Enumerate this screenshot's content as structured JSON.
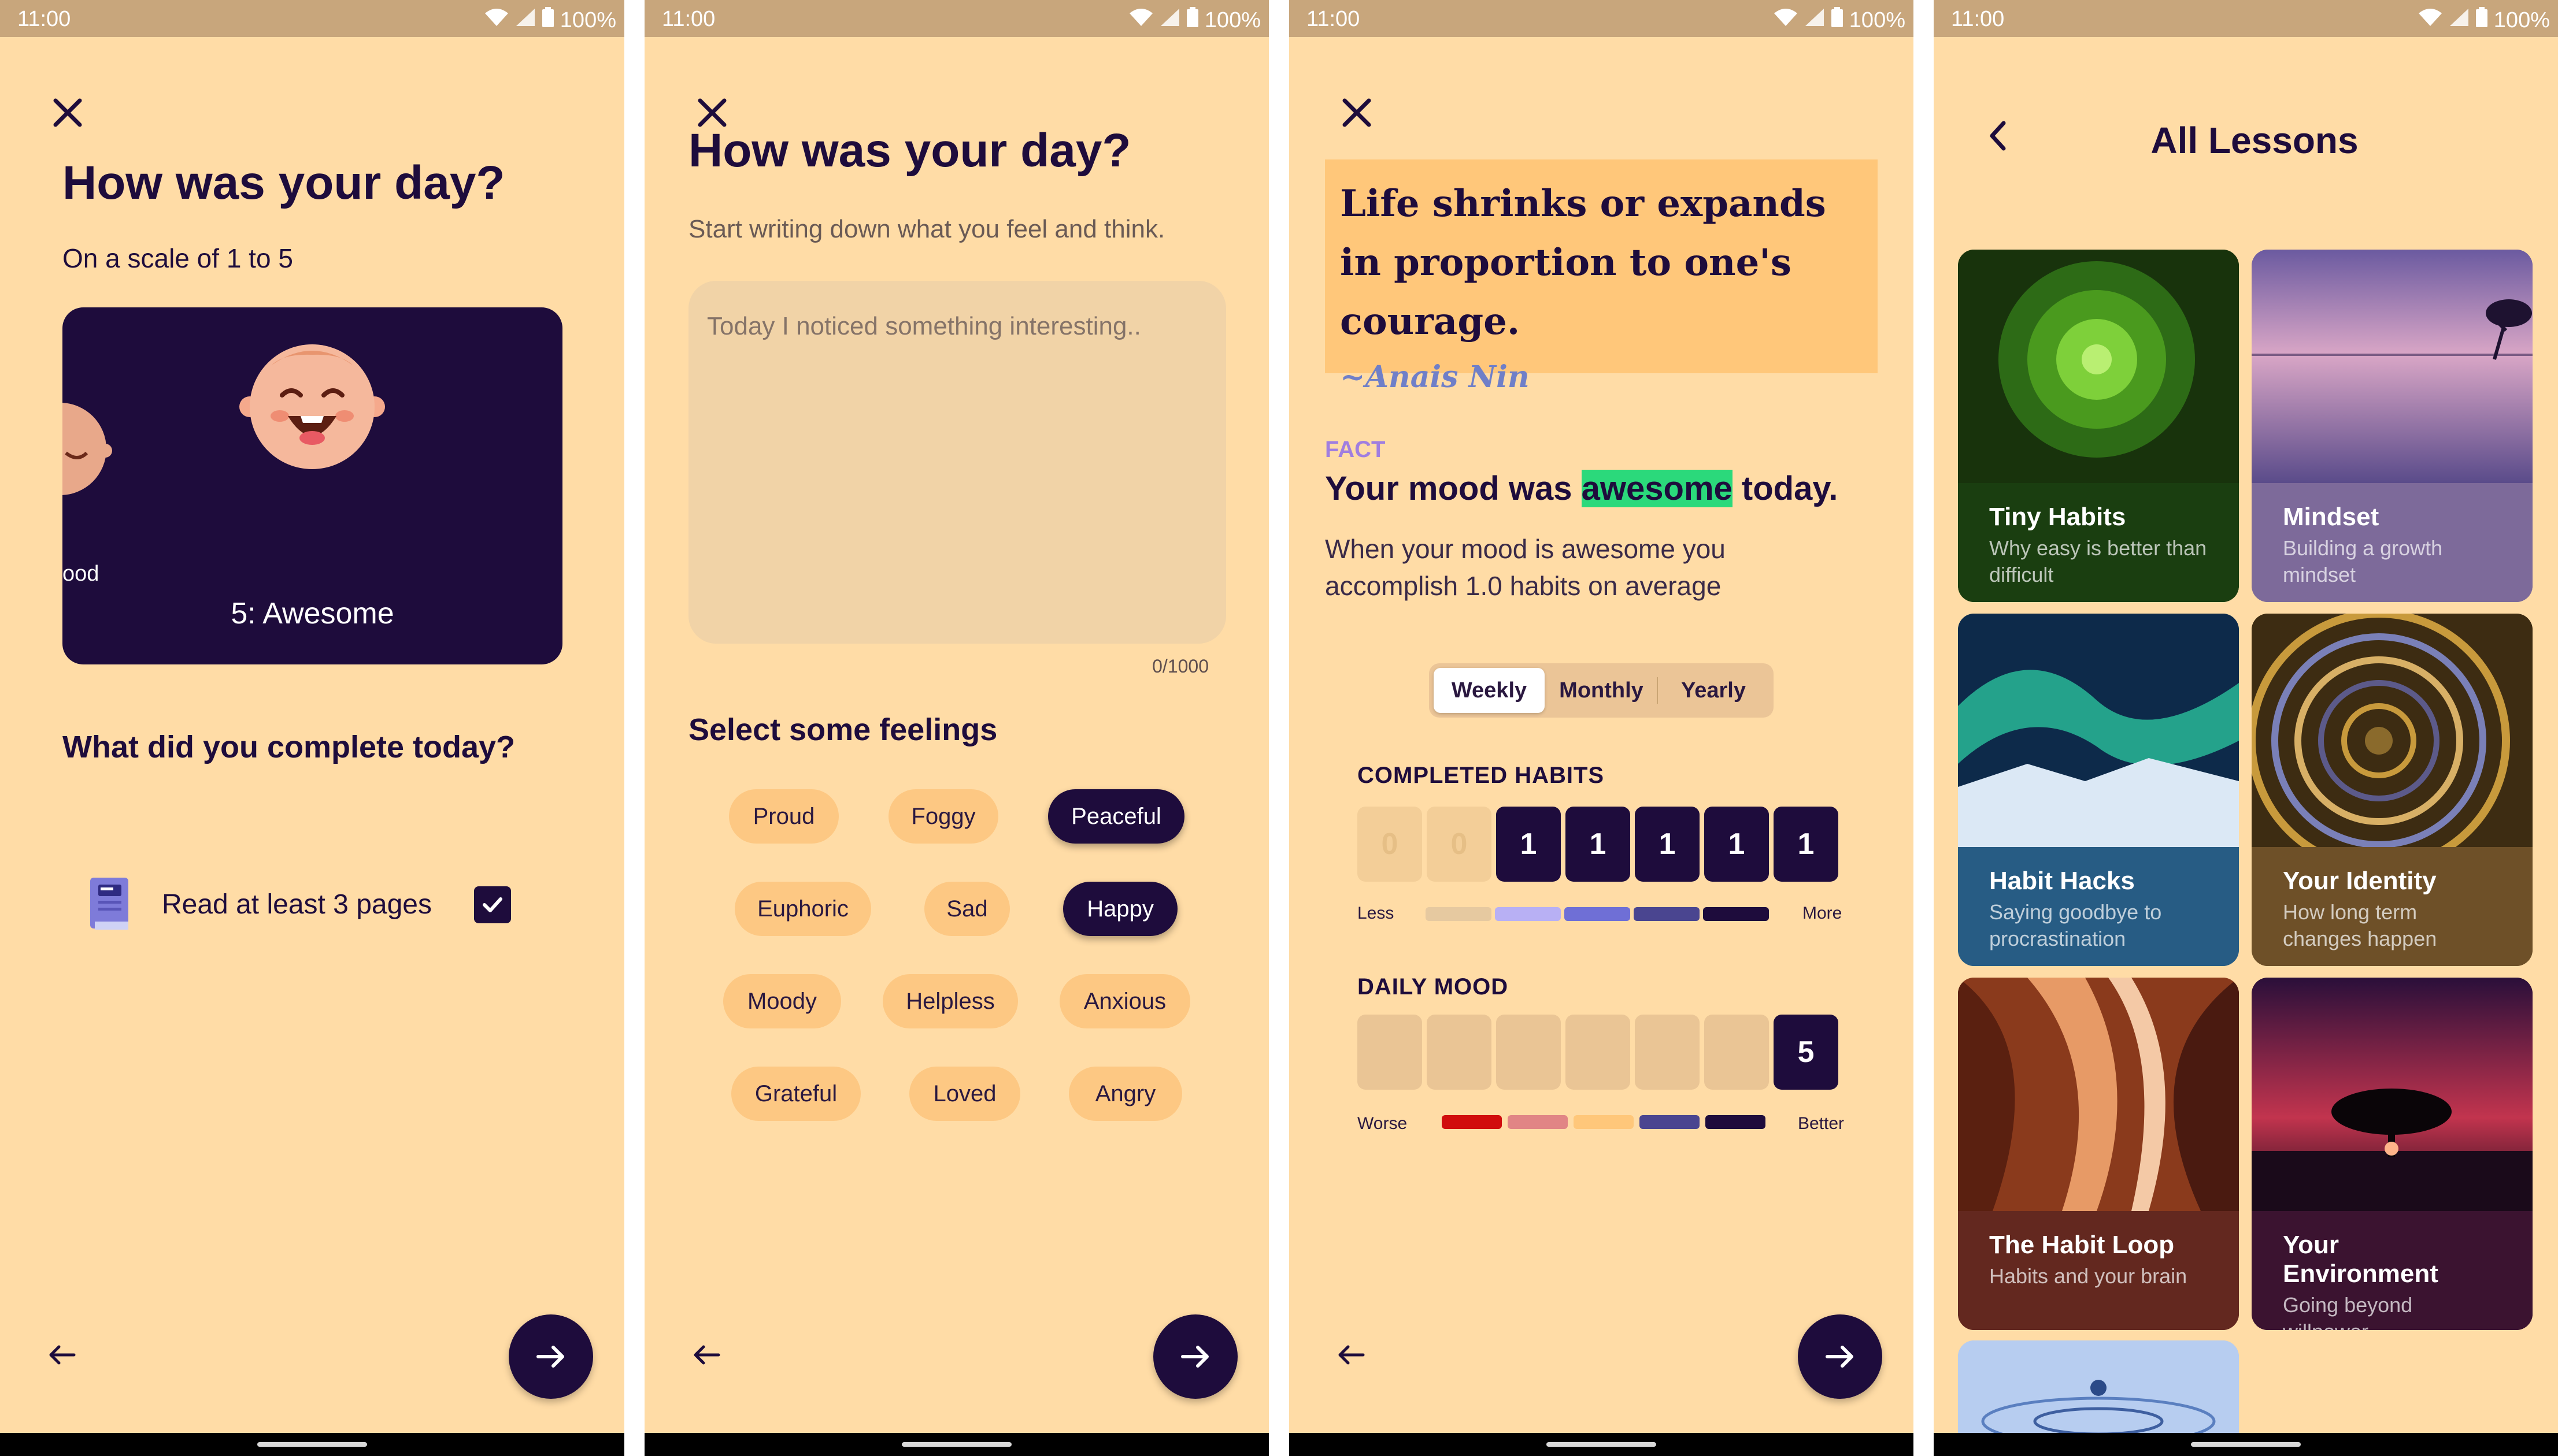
{
  "status": {
    "time": "11:00",
    "battery": "100%"
  },
  "screen1": {
    "title": "How was your day?",
    "subtitle": "On a scale of 1 to 5",
    "mood": {
      "label": "5: Awesome",
      "prev_label": "ood"
    },
    "question": "What did you complete today?",
    "habit": {
      "label": "Read at least 3 pages",
      "checked": true
    }
  },
  "screen2": {
    "title": "How was your day?",
    "subtitle": "Start writing down what you feel and think.",
    "placeholder": "Today I noticed something interesting..",
    "counter": "0/1000",
    "feelings_title": "Select some feelings",
    "feelings": [
      {
        "label": "Proud",
        "selected": false
      },
      {
        "label": "Foggy",
        "selected": false
      },
      {
        "label": "Peaceful",
        "selected": true
      },
      {
        "label": "Euphoric",
        "selected": false
      },
      {
        "label": "Sad",
        "selected": false
      },
      {
        "label": "Happy",
        "selected": true
      },
      {
        "label": "Moody",
        "selected": false
      },
      {
        "label": "Helpless",
        "selected": false
      },
      {
        "label": "Anxious",
        "selected": false
      },
      {
        "label": "Grateful",
        "selected": false
      },
      {
        "label": "Loved",
        "selected": false
      },
      {
        "label": "Angry",
        "selected": false
      }
    ]
  },
  "screen3": {
    "quote": "Life shrinks or expands in proportion to one's courage.",
    "author": "~Anais Nin",
    "fact_label": "FACT",
    "fact_title_pre": "Your mood was ",
    "fact_title_hl": "awesome",
    "fact_title_post": " today.",
    "fact_body": "When your mood is awesome you accomplish 1.0 habits on average",
    "periods": [
      "Weekly",
      "Monthly",
      "Yearly"
    ],
    "active_period": "Weekly",
    "habits_title": "COMPLETED HABITS",
    "habits": [
      "0",
      "0",
      "1",
      "1",
      "1",
      "1",
      "1"
    ],
    "less_label": "Less",
    "more_label": "More",
    "mood_title": "DAILY MOOD",
    "daily_mood": [
      "",
      "",
      "",
      "",
      "",
      "",
      "5"
    ],
    "worse_label": "Worse",
    "better_label": "Better",
    "habit_scale_colors": [
      "#e6c9a0",
      "#b8b0f4",
      "#6f6fd6",
      "#4a4590",
      "#1e0c3c"
    ],
    "mood_scale_colors": [
      "#d10d0d",
      "#e18585",
      "#ffc77a",
      "#4a4590",
      "#1e0c3c"
    ]
  },
  "screen4": {
    "title": "All Lessons",
    "lessons": [
      {
        "title": "Tiny Habits",
        "desc": "Why easy is better than difficult",
        "color": "#1a3e10"
      },
      {
        "title": "Mindset",
        "desc": "Building a growth mindset",
        "color": "#7d6a9a"
      },
      {
        "title": "Habit Hacks",
        "desc": "Saying goodbye to procrastination",
        "color": "#275c84"
      },
      {
        "title": "Your Identity",
        "desc": "How long term changes happen",
        "color": "#6e5028"
      },
      {
        "title": "The Habit Loop",
        "desc": "Habits and your brain",
        "color": "#63281f"
      },
      {
        "title": "Your Environment",
        "desc": "Going beyond willpower",
        "color": "#3b1330"
      }
    ]
  },
  "colors": {
    "background": "#ffdca6",
    "primary": "#1e0c3c",
    "chip": "#fdc883",
    "highlight": "#2bd97b"
  }
}
